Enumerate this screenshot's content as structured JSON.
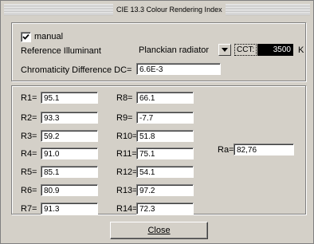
{
  "window": {
    "title": "CIE 13.3 Colour Rendering Index"
  },
  "settings": {
    "manual_label": "manual",
    "manual_checked": true,
    "reference_label": "Reference Illuminant",
    "reference_value": "Planckian radiator",
    "cct_label": "CCT:",
    "cct_value": "3500",
    "cct_unit": "K",
    "dc_label": "Chromaticity Difference DC=",
    "dc_value": "6.6E-3"
  },
  "indices": {
    "left": [
      {
        "label": "R1=",
        "value": "95.1"
      },
      {
        "label": "R2=",
        "value": "93.3"
      },
      {
        "label": "R3=",
        "value": "59.2"
      },
      {
        "label": "R4=",
        "value": "91.0"
      },
      {
        "label": "R5=",
        "value": "85.1"
      },
      {
        "label": "R6=",
        "value": "80.9"
      },
      {
        "label": "R7=",
        "value": "91.3"
      }
    ],
    "right": [
      {
        "label": "R8=",
        "value": "66.1"
      },
      {
        "label": "R9=",
        "value": "-7.7"
      },
      {
        "label": "R10=",
        "value": "51.8"
      },
      {
        "label": "R11=",
        "value": "75.1"
      },
      {
        "label": "R12=",
        "value": "54.1"
      },
      {
        "label": "R13=",
        "value": "97.2"
      },
      {
        "label": "R14=",
        "value": "72.3"
      }
    ],
    "ra_label": "Ra=",
    "ra_value": "82,76"
  },
  "footer": {
    "close_label": "Close"
  }
}
